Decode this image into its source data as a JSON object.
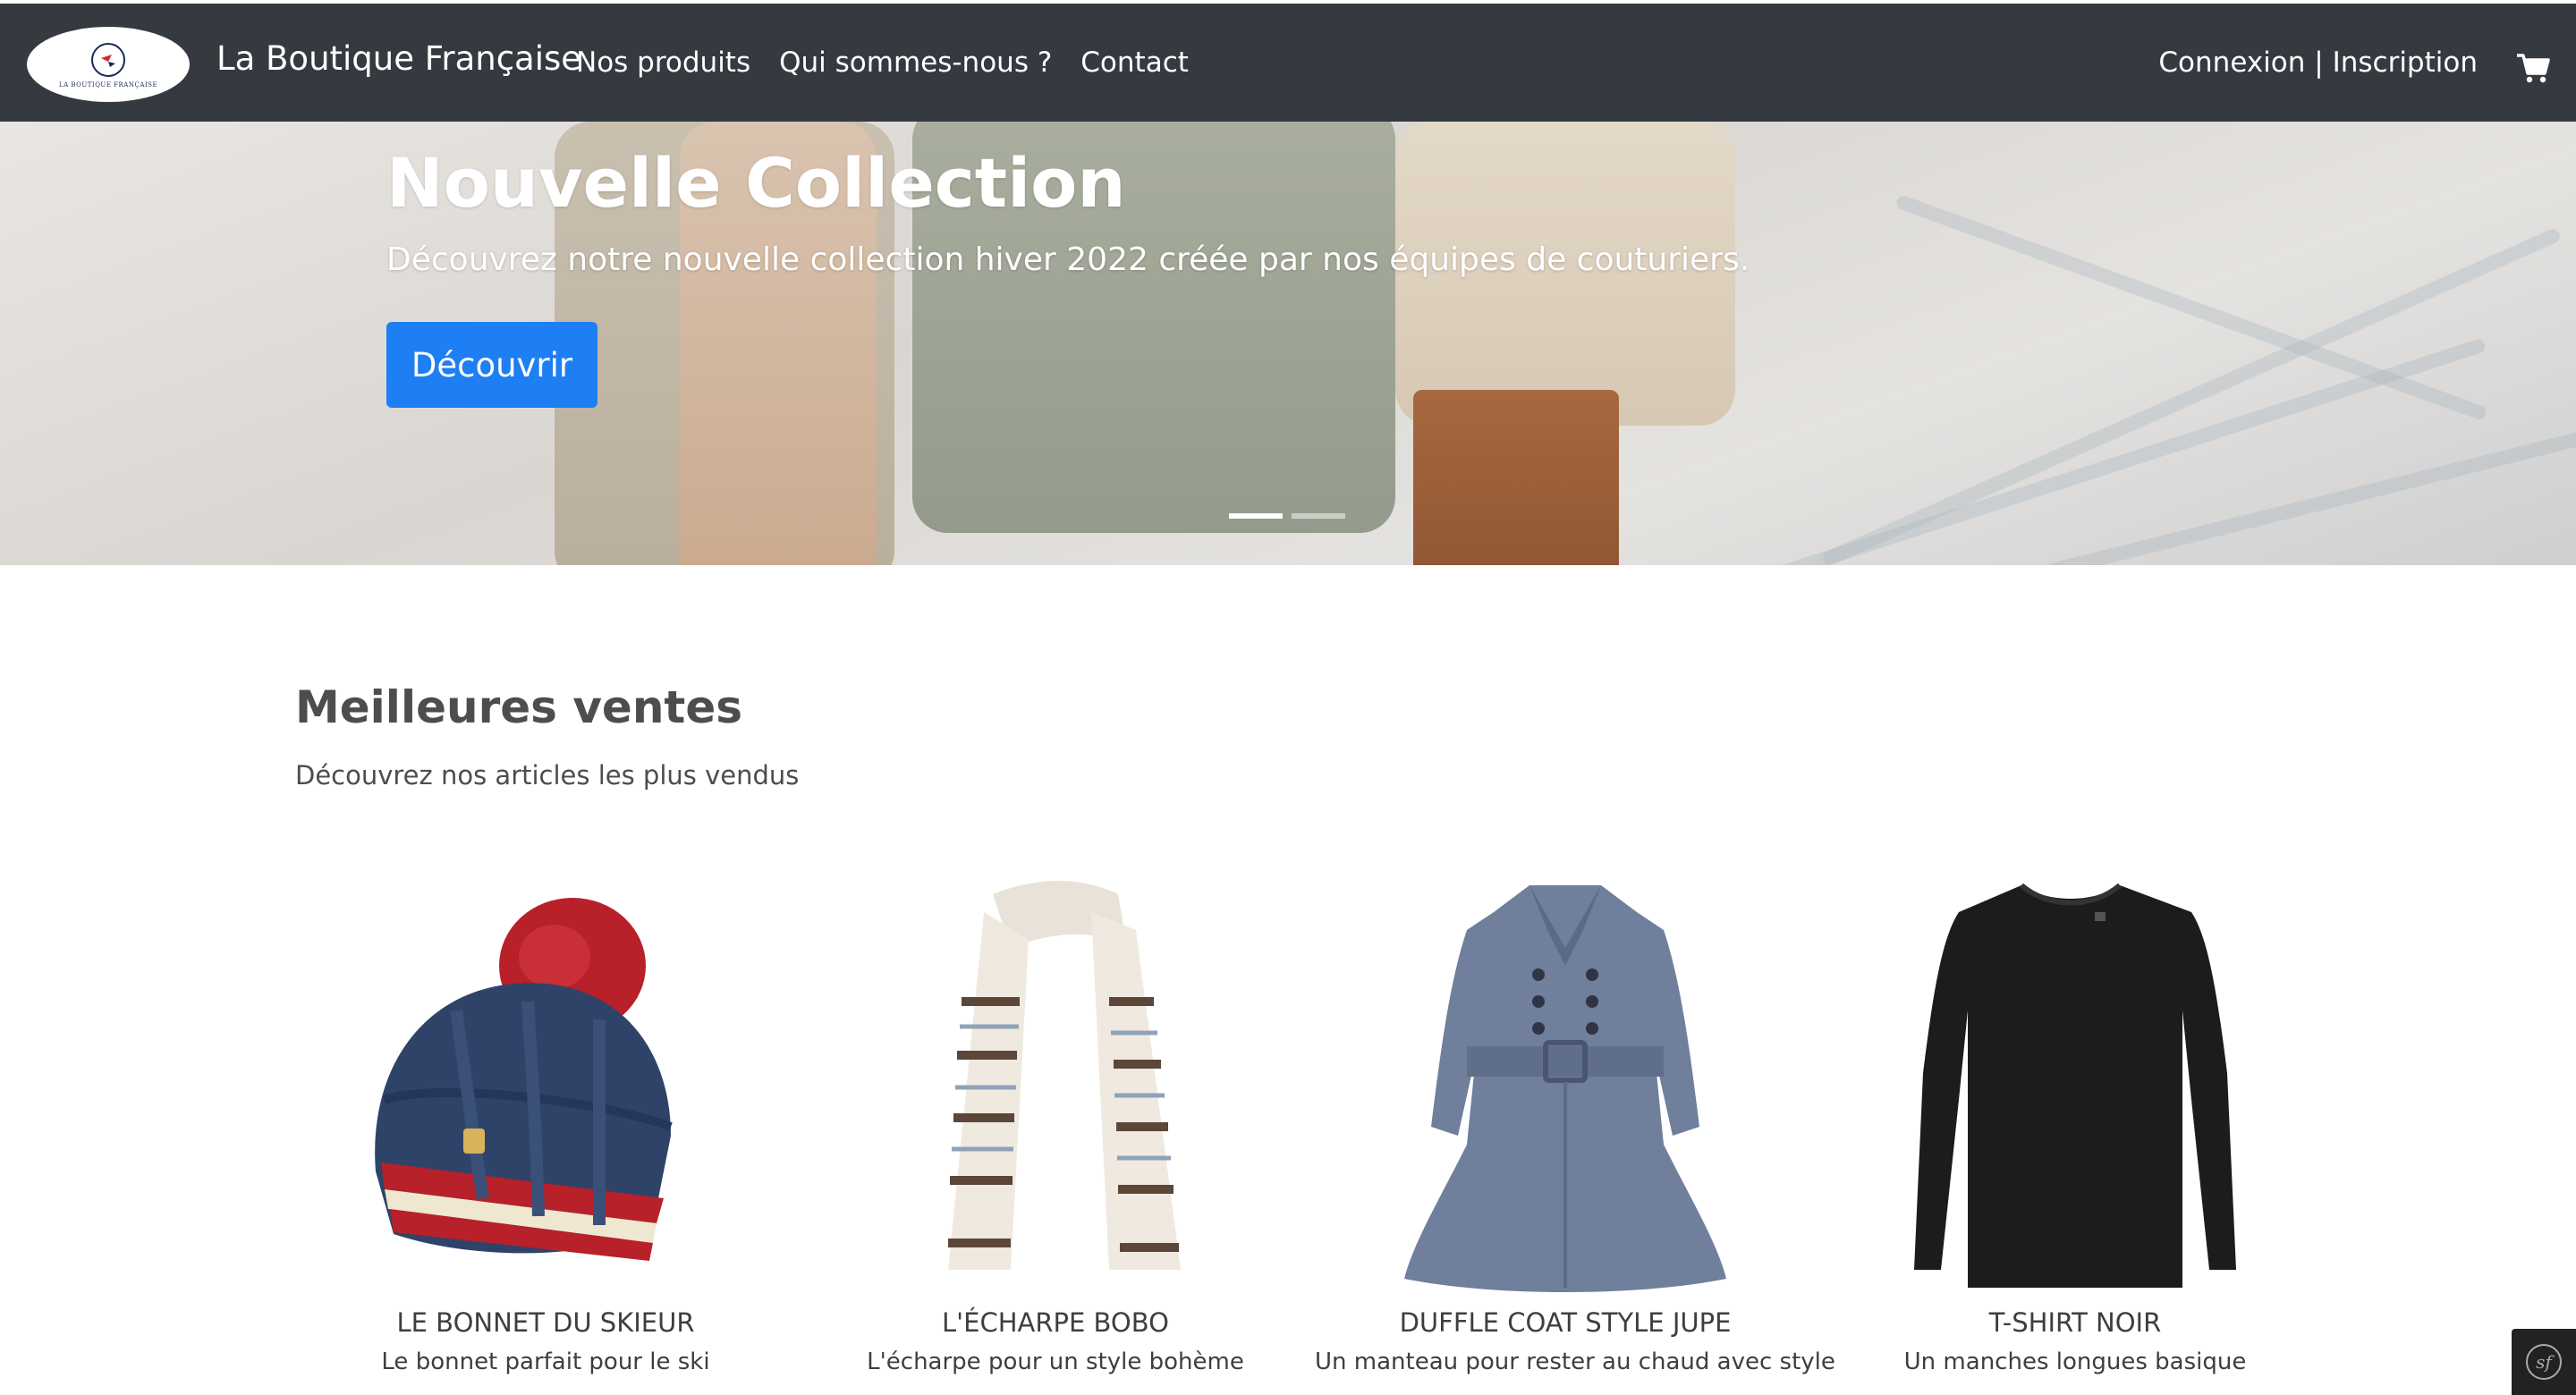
{
  "navbar": {
    "logo_text": "LA BOUTIQUE FRANÇAISE",
    "brand": "La Boutique Française",
    "links": [
      {
        "label": "Nos produits"
      },
      {
        "label": "Qui sommes-nous ?"
      },
      {
        "label": "Contact"
      }
    ],
    "login_label": "Connexion",
    "separator": "|",
    "register_label": "Inscription",
    "cart_icon": "cart-icon"
  },
  "hero": {
    "title": "Nouvelle Collection",
    "subtitle": "Découvrez notre nouvelle collection hiver 2022 créée par nos équipes de couturiers.",
    "button_label": "Découvrir",
    "slides_count": 2,
    "active_slide": 1
  },
  "best_sellers": {
    "title": "Meilleures ventes",
    "subtitle": "Découvrez nos articles les plus vendus",
    "products": [
      {
        "name": "LE BONNET DU SKIEUR",
        "description": "Le bonnet parfait pour le ski",
        "image": "beanie-image"
      },
      {
        "name": "L'ÉCHARPE BOBO",
        "description": "L'écharpe pour un style bohème",
        "image": "scarf-image"
      },
      {
        "name": "DUFFLE COAT STYLE JUPE",
        "description": "Un manteau pour rester au chaud avec style",
        "image": "coat-image"
      },
      {
        "name": "T-SHIRT NOIR",
        "description": "Un manches longues basique",
        "image": "tshirt-image"
      }
    ]
  },
  "colors": {
    "navbar_bg": "#343a40",
    "primary_button": "#1e7ef4",
    "text_dark": "#4d4d4d"
  },
  "debug_toolbar_icon": "symfony-icon"
}
